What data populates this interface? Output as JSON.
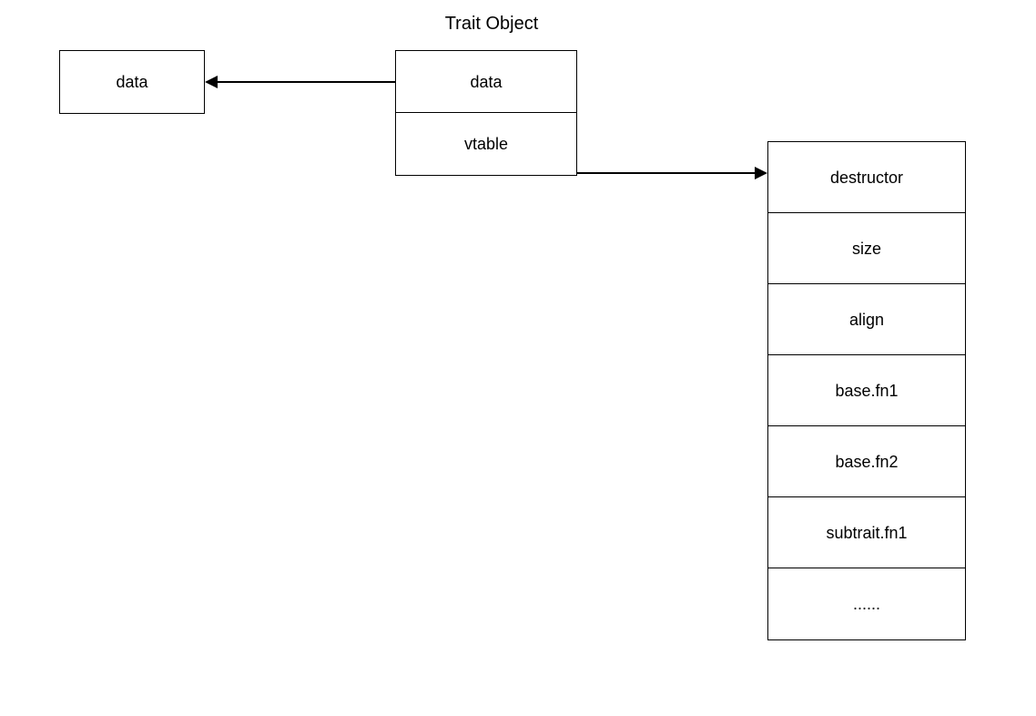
{
  "title": "Trait Object",
  "left_box": {
    "label": "data"
  },
  "trait_object": {
    "data_label": "data",
    "vtable_label": "vtable"
  },
  "vtable_entries": [
    "destructor",
    "size",
    "align",
    "base.fn1",
    "base.fn2",
    "subtrait.fn1",
    "......"
  ],
  "chart_data": {
    "type": "diagram",
    "title": "Trait Object",
    "nodes": [
      {
        "id": "data-concrete",
        "label": "data"
      },
      {
        "id": "trait-object",
        "fields": [
          "data",
          "vtable"
        ]
      },
      {
        "id": "vtable",
        "fields": [
          "destructor",
          "size",
          "align",
          "base.fn1",
          "base.fn2",
          "subtrait.fn1",
          "......"
        ]
      }
    ],
    "edges": [
      {
        "from": "trait-object.data",
        "to": "data-concrete"
      },
      {
        "from": "trait-object.vtable",
        "to": "vtable"
      }
    ]
  }
}
